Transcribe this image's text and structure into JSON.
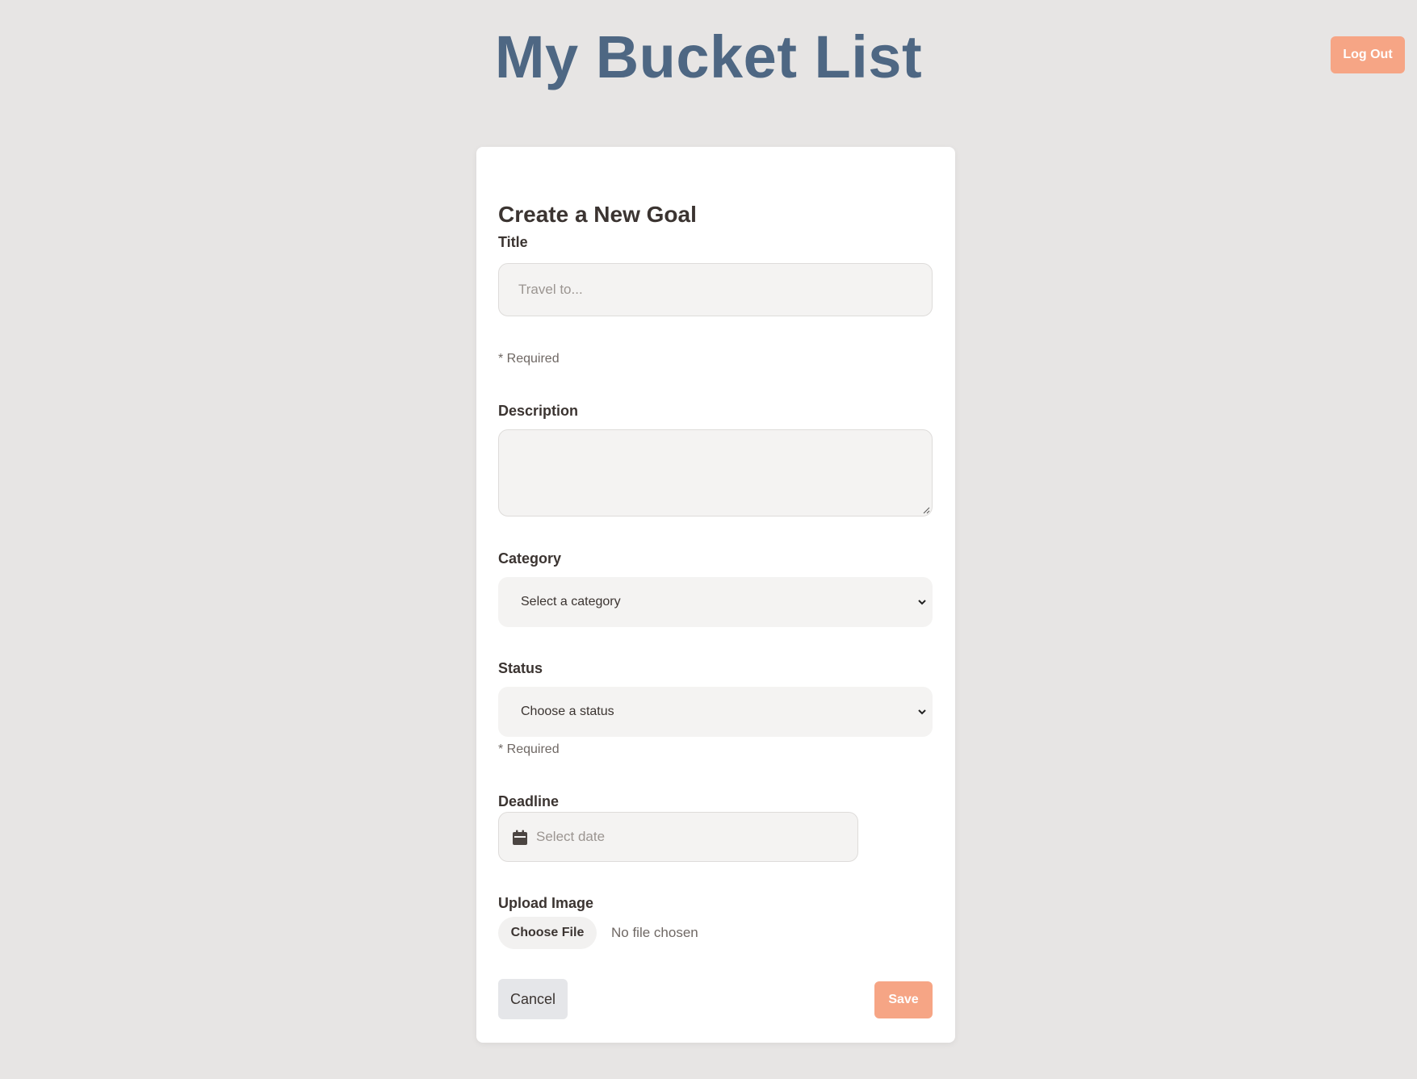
{
  "header": {
    "title": "My Bucket List",
    "logout_label": "Log Out"
  },
  "form": {
    "heading": "Create a New Goal",
    "title_field": {
      "label": "Title",
      "placeholder": "Travel to...",
      "hint": "* Required"
    },
    "description_field": {
      "label": "Description",
      "value": ""
    },
    "category_field": {
      "label": "Category",
      "selected": "Select a category"
    },
    "status_field": {
      "label": "Status",
      "selected": "Choose a status",
      "hint": "* Required"
    },
    "deadline_field": {
      "label": "Deadline",
      "placeholder": "Select date"
    },
    "image_field": {
      "label": "Upload Image",
      "button_label": "Choose File",
      "file_status": "No file chosen"
    },
    "actions": {
      "cancel_label": "Cancel",
      "save_label": "Save"
    }
  },
  "colors": {
    "page_background": "#e7e5e4",
    "title": "#4e6783",
    "accent": "#f6a585",
    "card": "#ffffff",
    "field_background": "#f4f3f2"
  },
  "icons": {
    "select_arrow": "chevron-down-icon",
    "deadline": "calendar-icon"
  }
}
